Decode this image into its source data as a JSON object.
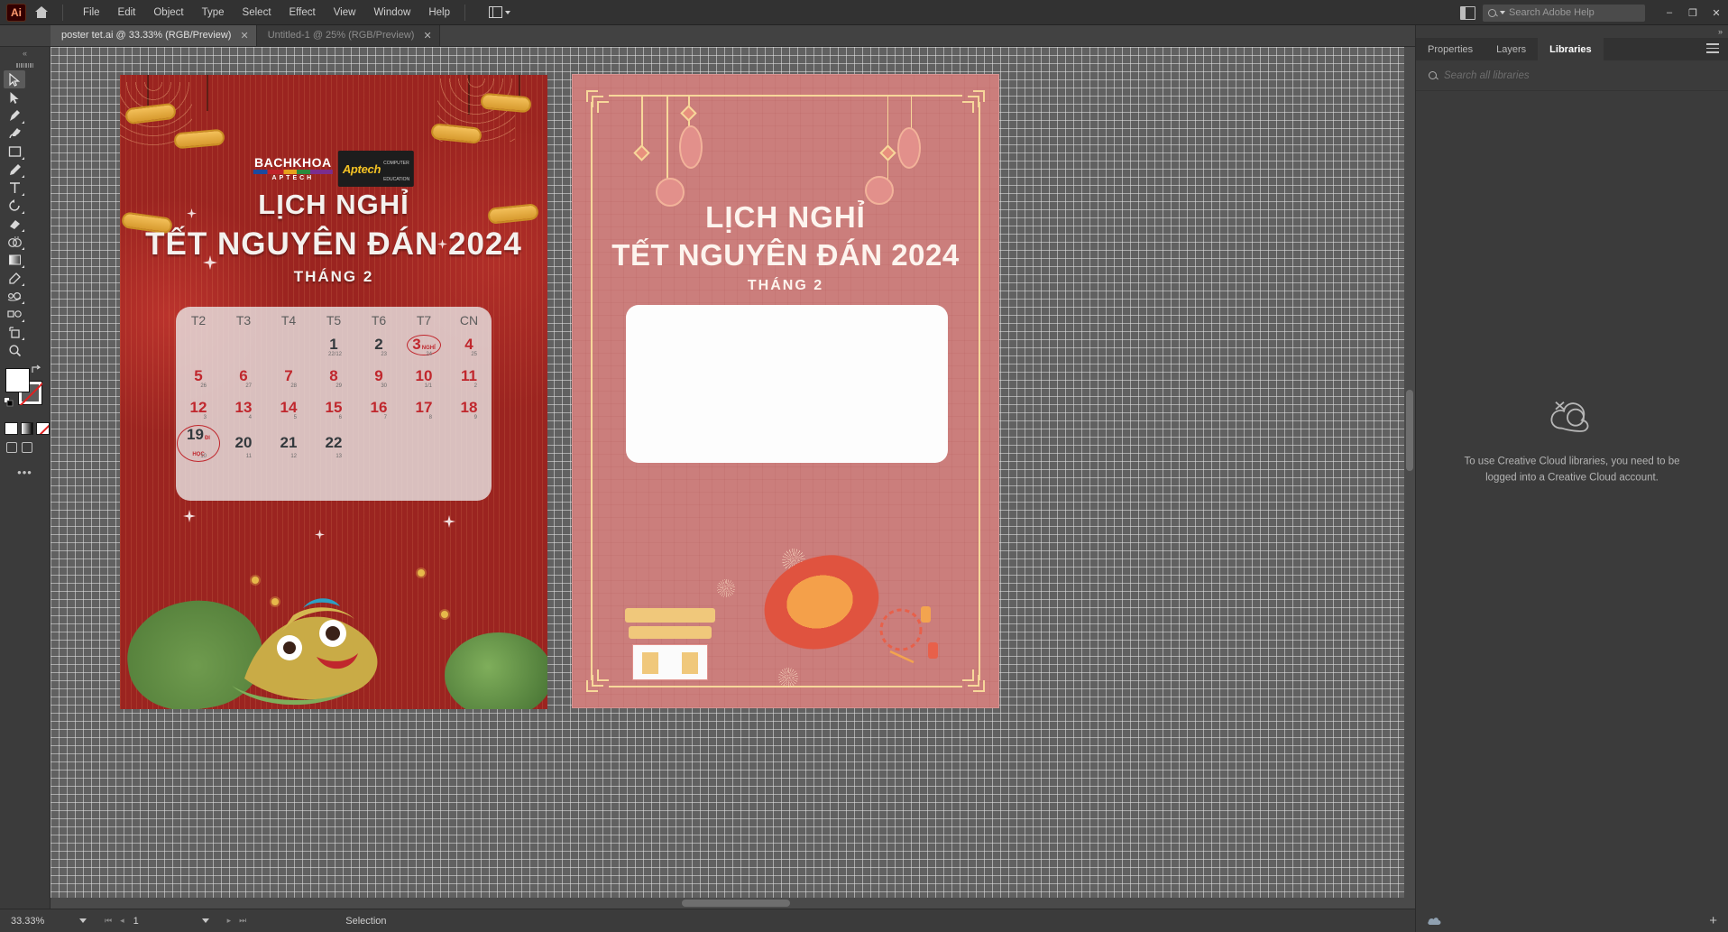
{
  "app": {
    "logo": "Ai",
    "home_icon": "home-icon",
    "arrange_icon": "arrange-documents-icon",
    "doc_layout_icon": "document-layout-icon"
  },
  "menu": {
    "items": [
      "File",
      "Edit",
      "Object",
      "Type",
      "Select",
      "Effect",
      "View",
      "Window",
      "Help"
    ]
  },
  "help_search": {
    "placeholder": "Search Adobe Help",
    "icon": "search-icon"
  },
  "window_controls": {
    "minimize": "–",
    "restore": "❐",
    "close": "✕"
  },
  "tabs": [
    {
      "label": "poster tet.ai @ 33.33% (RGB/Preview)",
      "close": "✕",
      "active": true
    },
    {
      "label": "Untitled-1 @ 25% (RGB/Preview)",
      "close": "✕",
      "active": false
    }
  ],
  "toolbar": {
    "tools": [
      {
        "name": "selection-tool",
        "selected": true
      },
      {
        "name": "direct-selection-tool",
        "selected": false
      },
      {
        "name": "pen-tool",
        "selected": false
      },
      {
        "name": "curvature-tool",
        "selected": false
      },
      {
        "name": "rectangle-tool",
        "selected": false
      },
      {
        "name": "paintbrush-tool",
        "selected": false
      },
      {
        "name": "type-tool",
        "selected": false
      },
      {
        "name": "rotate-tool",
        "selected": false
      },
      {
        "name": "eraser-tool",
        "selected": false
      },
      {
        "name": "shape-builder-tool",
        "selected": false
      },
      {
        "name": "gradient-tool",
        "selected": false
      },
      {
        "name": "eyedropper-tool",
        "selected": false
      },
      {
        "name": "blend-tool",
        "selected": false
      },
      {
        "name": "symbol-sprayer-tool",
        "selected": false
      },
      {
        "name": "artboard-tool",
        "selected": false
      },
      {
        "name": "zoom-tool",
        "selected": false
      }
    ],
    "fill_color": "#ffffff",
    "stroke_color": "#ffffff",
    "swap_icon": "swap-fill-stroke-icon",
    "default_icon": "default-fill-stroke-icon",
    "fill_modes": [
      "color-fill",
      "gradient-fill",
      "none-fill"
    ],
    "screen_modes": [
      "normal-screen-mode",
      "full-screen-mode"
    ],
    "more_tools": "•••"
  },
  "artwork": {
    "poster1": {
      "brand": {
        "line1": "BACHKHOA",
        "line2": "APTECH",
        "partner": "Aptech",
        "partner_sub_1": "COMPUTER",
        "partner_sub_2": "EDUCATION"
      },
      "title_line1": "LỊCH NGHỈ",
      "title_line2": "TẾT NGUYÊN ĐÁN 2024",
      "subtitle": "THÁNG 2",
      "calendar": {
        "headers": [
          "T2",
          "T3",
          "T4",
          "T5",
          "T6",
          "T7",
          "CN"
        ],
        "rows": [
          [
            {
              "day": "",
              "lunar": "",
              "style": ""
            },
            {
              "day": "",
              "lunar": "",
              "style": ""
            },
            {
              "day": "",
              "lunar": "",
              "style": ""
            },
            {
              "day": "1",
              "lunar": "22/12",
              "style": "dark"
            },
            {
              "day": "2",
              "lunar": "23",
              "style": "dark"
            },
            {
              "day": "3",
              "lunar": "24",
              "style": "red",
              "circled": true,
              "tag": "NGHỈ"
            },
            {
              "day": "4",
              "lunar": "25",
              "style": "red"
            }
          ],
          [
            {
              "day": "5",
              "lunar": "26",
              "style": "red"
            },
            {
              "day": "6",
              "lunar": "27",
              "style": "red"
            },
            {
              "day": "7",
              "lunar": "28",
              "style": "red"
            },
            {
              "day": "8",
              "lunar": "29",
              "style": "red"
            },
            {
              "day": "9",
              "lunar": "30",
              "style": "red"
            },
            {
              "day": "10",
              "lunar": "1/1",
              "style": "red"
            },
            {
              "day": "11",
              "lunar": "2",
              "style": "red"
            }
          ],
          [
            {
              "day": "12",
              "lunar": "3",
              "style": "red"
            },
            {
              "day": "13",
              "lunar": "4",
              "style": "red"
            },
            {
              "day": "14",
              "lunar": "5",
              "style": "red"
            },
            {
              "day": "15",
              "lunar": "6",
              "style": "red"
            },
            {
              "day": "16",
              "lunar": "7",
              "style": "red"
            },
            {
              "day": "17",
              "lunar": "8",
              "style": "red"
            },
            {
              "day": "18",
              "lunar": "9",
              "style": "red"
            }
          ],
          [
            {
              "day": "19",
              "lunar": "10",
              "style": "dark",
              "circled": true,
              "tag": "ĐI HỌC"
            },
            {
              "day": "20",
              "lunar": "11",
              "style": "dark"
            },
            {
              "day": "21",
              "lunar": "12",
              "style": "dark"
            },
            {
              "day": "22",
              "lunar": "13",
              "style": "dark"
            },
            {
              "day": "",
              "lunar": "",
              "style": ""
            },
            {
              "day": "",
              "lunar": "",
              "style": ""
            },
            {
              "day": "",
              "lunar": "",
              "style": ""
            }
          ]
        ]
      },
      "colors": {
        "background": "#9b2420",
        "title": "#f4f1ee",
        "day_red": "#c0272d",
        "day_dark": "#33393d",
        "gold": "#e6b84a"
      }
    },
    "poster2": {
      "title_line1": "LỊCH NGHỈ",
      "title_line2": "TẾT NGUYÊN ĐÁN 2024",
      "subtitle": "THÁNG 2",
      "colors": {
        "background": "#cb7e7c",
        "frame": "#f7d79a",
        "title": "#fdf4ee",
        "panel": "#fdfdfd"
      }
    }
  },
  "status_bar": {
    "zoom": "33.33%",
    "page": "1",
    "tool_status": "Selection",
    "first_icon": "first-artboard-icon",
    "prev_icon": "previous-artboard-icon",
    "next_icon": "next-artboard-icon",
    "last_icon": "last-artboard-icon"
  },
  "right_panel": {
    "tabs": [
      {
        "label": "Properties",
        "active": false
      },
      {
        "label": "Layers",
        "active": false
      },
      {
        "label": "Libraries",
        "active": true
      }
    ],
    "menu_icon": "panel-menu-icon",
    "collapse_icon": "expand-panel-icon",
    "search_placeholder": "Search all libraries",
    "search_icon": "search-icon",
    "empty_icon": "creative-cloud-disconnected-icon",
    "empty_message": "To use Creative Cloud libraries, you need to be logged into a Creative Cloud account.",
    "sync_icon": "cloud-sync-icon",
    "add_icon": "+"
  }
}
